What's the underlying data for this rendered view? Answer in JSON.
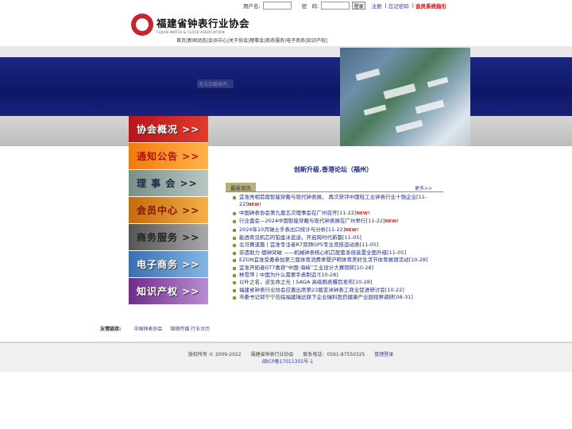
{
  "login": {
    "username_label": "用户名:",
    "password_label": "密　码:",
    "login_button": "登录",
    "register": "注册",
    "forgot": "忘记密码",
    "member_system": "会员系统指引"
  },
  "logo": {
    "name_cn": "福建省钟表行业协会",
    "name_en": "FUJIAN WATCH & CLOCK ASSOCIATION"
  },
  "topnav": "首页|新闻动态|会员中心|关于协会|理事会|商务服务|电子商务|知识产权|",
  "banner": {
    "flash_message": "无法加载插件。"
  },
  "sidemenu": [
    "协会概况 >>",
    "通知公告 >>",
    "理 事 会 >>",
    "会员中心 >>",
    "商务服务 >>",
    "电子商务 >>",
    "知识产权 >>"
  ],
  "headline": "创新升级.香港论坛（福州）",
  "news_section": {
    "tab": "最新资讯",
    "more": "更多>>"
  },
  "news": [
    {
      "title": "宜准亮相首届智能穿戴与现代钟表展， 再次获评中国轻工业钟表行业十强企业",
      "date": "[11-22]",
      "new": "NEW!"
    },
    {
      "title": "中国钟表协会第九届五次理事会在广州召开",
      "date": "[11-22]",
      "new": "NEW!"
    },
    {
      "title": "行业盛会—2024中国智能穿戴与现代钟表展在广州举行",
      "date": "[11-22]",
      "new": "NEW!"
    },
    {
      "title": "2024年10月瑞士手表出口统计与分析",
      "date": "[11-22]",
      "new": "NEW!"
    },
    {
      "title": "能透背见机芯的铂金冰蓝迪，开启跨时代新篇",
      "date": "[11-05]",
      "new": ""
    },
    {
      "title": "北马赛道篇 | 宜准专注者R7双频GPS专业竞技运动表",
      "date": "[11-05]",
      "new": ""
    },
    {
      "title": "非遗助力·烟钟突破 ——机械钟表核心机芯配套系统装置全面升级",
      "date": "[11-05]",
      "new": ""
    },
    {
      "title": "EZON宜准受邀参加第三届体育消费季暨沪明体育美好生活节体育展销活动",
      "date": "[10-28]",
      "new": ""
    },
    {
      "title": "宜准开拓者GT7喜获“中国·海峡”工业设计大赛铜奖",
      "date": "[10-28]",
      "new": ""
    },
    {
      "title": "林雪萍 | 中国为什么需要手表制造?",
      "date": "[10-28]",
      "new": ""
    },
    {
      "title": "以叶之名，逆生命之光 | SAGA 高级腕表耀目发布",
      "date": "[10-28]",
      "new": ""
    },
    {
      "title": "福建省钟表行业协会应邀出席第23届亚洲钟表工商业促进研讨会",
      "date": "[10-22]",
      "new": ""
    },
    {
      "title": "市委书记郭宁宁莅临福建瑞达旗下企业瑞科医药健康产业园视察调研",
      "date": "[08-31]",
      "new": ""
    }
  ],
  "friends": {
    "label": "友情链接:",
    "links": [
      "中国钟表协会",
      "锦钢传媒.行业台历"
    ]
  },
  "footer": {
    "copyright": "版权所有 © 2009-2022",
    "org": "福建省钟表行业协会",
    "phone": "联系电话：0591-87550325",
    "admin": "管理登录",
    "icp": "闽ICP备17011355号-1"
  }
}
